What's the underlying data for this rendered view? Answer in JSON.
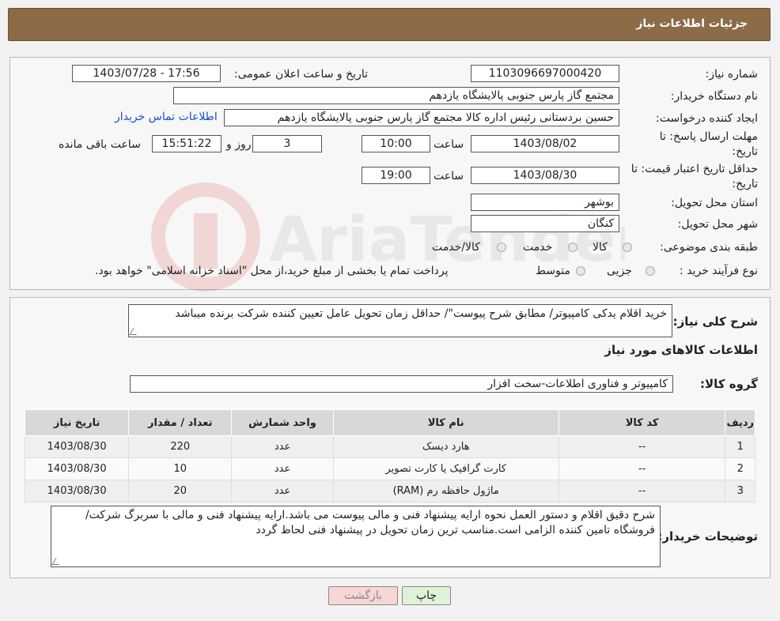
{
  "page_title": "جزئیات اطلاعات نیاز",
  "fields": {
    "need_number_label": "شماره نیاز:",
    "need_number": "1103096697000420",
    "announce_label": "تاریخ و ساعت اعلان عمومی:",
    "announce_value": "1403/07/28 - 17:56",
    "buyer_org_label": "نام دستگاه خریدار:",
    "buyer_org": "مجتمع گاز پارس جنوبی  پالایشگاه یازدهم",
    "requester_label": "ایجاد کننده درخواست:",
    "requester": "حسین بردستانی رئیس اداره کالا مجتمع گاز پارس جنوبی  پالایشگاه یازدهم",
    "contact_link": "اطلاعات تماس خریدار",
    "deadline_label_1": "مهلت ارسال پاسخ: تا",
    "deadline_label_2": "تاریخ:",
    "deadline_date": "1403/08/02",
    "time_label": "ساعت",
    "deadline_time": "10:00",
    "days_value": "3",
    "days_label": "روز و",
    "remaining_time": "15:51:22",
    "remaining_label": "ساعت باقی مانده",
    "validity_label_1": "حداقل تاریخ اعتبار قیمت: تا",
    "validity_label_2": "تاریخ:",
    "validity_date": "1403/08/30",
    "validity_time": "19:00",
    "province_label": "استان محل تحویل:",
    "province": "بوشهر",
    "city_label": "شهر محل تحویل:",
    "city": "کنگان",
    "category_label": "طبقه بندی موضوعی:",
    "category_options": [
      "کالا",
      "خدمت",
      "کالا/خدمت"
    ],
    "process_label": "نوع فرآیند خرید :",
    "process_options": [
      "جزیی",
      "متوسط"
    ],
    "process_note": "پرداخت تمام یا بخشی از مبلغ خرید،از محل \"اسناد خزانه اسلامی\" خواهد بود."
  },
  "summary": {
    "label": "شرح کلی نیاز:",
    "text": "خرید اقلام یدکی کامپیوتر/ مطابق شرح پیوست\"/ حداقل زمان تحویل عامل تعیین کننده شرکت برنده میباشد"
  },
  "goods_info_title": "اطلاعات کالاهای مورد نیاز",
  "goods_group": {
    "label": "گروه کالا:",
    "value": "کامپیوتر و فناوری اطلاعات-سخت افزار"
  },
  "table": {
    "headers": [
      "ردیف",
      "کد کالا",
      "نام کالا",
      "واحد شمارش",
      "تعداد / مقدار",
      "تاریخ نیاز"
    ],
    "rows": [
      [
        "1",
        "--",
        "هارد دیسک",
        "عدد",
        "220",
        "1403/08/30"
      ],
      [
        "2",
        "--",
        "کارت گرافیک یا کارت تصویر",
        "عدد",
        "10",
        "1403/08/30"
      ],
      [
        "3",
        "--",
        "ماژول حافظه رم (RAM)",
        "عدد",
        "20",
        "1403/08/30"
      ]
    ]
  },
  "buyer_notes": {
    "label": "توضیحات خریدار:",
    "text": "شرح دقیق اقلام و دستور العمل نحوه ارایه پیشنهاد فنی و مالی پیوست می باشد.ارایه پیشنهاد فنی و مالی با سربرگ شرکت/فروشگاه تامین کننده الزامی است.مناسب ترین زمان تحویل در پیشنهاد فنی لحاظ گردد"
  },
  "buttons": {
    "print": "چاپ",
    "back": "بازگشت"
  },
  "colors": {
    "header_bg": "#8c6b47",
    "link": "#1a4fd0",
    "back_btn_bg": "#f7d6d6",
    "print_btn_bg": "#ddf2d6"
  }
}
